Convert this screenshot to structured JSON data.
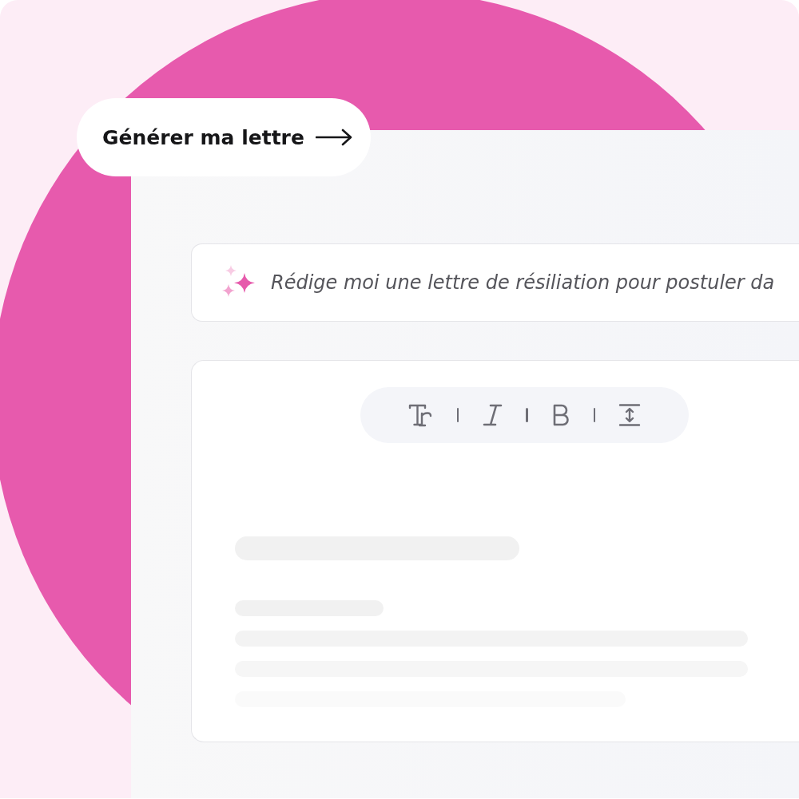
{
  "action_button": {
    "label": "Générer ma lettre"
  },
  "prompt": {
    "placeholder": "Rédige moi une lettre de résiliation pour postuler da"
  },
  "toolbar": {
    "tools": [
      {
        "kind": "text-size"
      },
      {
        "kind": "italic"
      },
      {
        "kind": "bold"
      },
      {
        "kind": "line-height"
      }
    ]
  }
}
